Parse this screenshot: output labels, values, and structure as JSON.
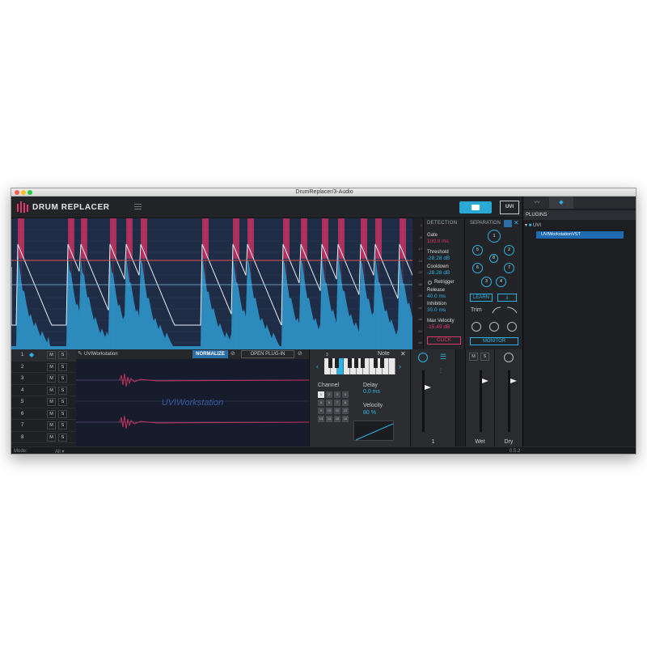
{
  "window": {
    "title": "DrumReplacer/3-Audio"
  },
  "header": {
    "brand": "DRUM REPLACER",
    "vendor_logo": "UVI"
  },
  "scale": {
    "ticks": [
      "0",
      "-6",
      "-12",
      "-18",
      "-24",
      "-30",
      "-36",
      "-42",
      "-48",
      "-54",
      "-60"
    ]
  },
  "detection": {
    "title": "DETECTION",
    "gate_label": "Gate",
    "gate_value": "100.0 ms",
    "threshold_label": "Threshold",
    "threshold_value": "-28.28 dB",
    "cooldown_label": "Cooldown",
    "cooldown_value": "-28.28 dB",
    "retrigger_label": "Retrigger",
    "release_label": "Release",
    "release_value": "40.0 ms",
    "inhibition_label": "Inhibition",
    "inhibition_value": "30.0 ms",
    "maxvel_label": "Max Velocity",
    "maxvel_value": "-15.49 dB",
    "click_label": "CLICK"
  },
  "separation": {
    "title": "SEPARATION",
    "pads": [
      "1",
      "5",
      "2",
      "8",
      "6",
      "7",
      "3",
      "4"
    ],
    "learn_label": "LEARN",
    "trim_label": "Trim",
    "monitor_label": "MONITOR"
  },
  "tracks": {
    "rows": [
      "1",
      "2",
      "3",
      "4",
      "5",
      "6",
      "7",
      "8"
    ],
    "mute": "M",
    "solo": "S"
  },
  "plugin": {
    "name": "UVIWorkstation",
    "normalize_label": "NORMALIZE",
    "open_label": "OPEN PLUG-IN",
    "display_label": "UVIWorkstation"
  },
  "midi": {
    "note_label": "Note",
    "octave": "3",
    "channel_label": "Channel",
    "channels": [
      "1",
      "2",
      "3",
      "4",
      "5",
      "6",
      "7",
      "8",
      "9",
      "10",
      "11",
      "12",
      "13",
      "14",
      "15",
      "16"
    ],
    "delay_label": "Delay",
    "delay_value": "0.0 ms",
    "velocity_label": "Velocity",
    "velocity_value": "80 %"
  },
  "faders": {
    "track_label": "1",
    "wet_label": "Wet",
    "dry_label": "Dry",
    "mute": "M",
    "solo": "S"
  },
  "right_panel": {
    "section": "PLUGINS",
    "folder": "UVI",
    "item": "UVIWorkstationVST"
  },
  "status": {
    "mode_label": "Mode:",
    "mode_value": "All",
    "version": "0.5.2"
  },
  "colors": {
    "accent": "#2ab4e6",
    "hit": "#c2325f",
    "wave": "#2e8fc4",
    "threshold": "#e0545a"
  }
}
